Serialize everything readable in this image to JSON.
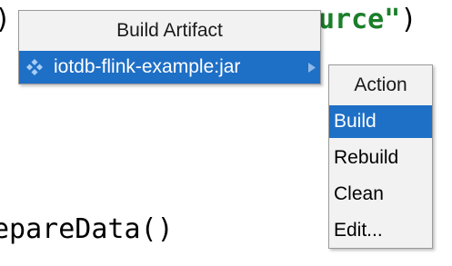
{
  "editor": {
    "top_left_fragment": ")",
    "top_right_string": "urce\"",
    "top_right_paren": ")",
    "bottom_fragment": "epareData()"
  },
  "popup": {
    "title": "Build Artifact",
    "artifact": {
      "label": "iotdb-flink-example:jar",
      "icon": "artifact-diamond-icon",
      "expand_icon": "chevron-right-icon"
    }
  },
  "submenu": {
    "title": "Action",
    "items": [
      {
        "label": "Build",
        "selected": true
      },
      {
        "label": "Rebuild",
        "selected": false
      },
      {
        "label": "Clean",
        "selected": false
      },
      {
        "label": "Edit...",
        "selected": false
      }
    ]
  },
  "colors": {
    "selection": "#1e6fc6",
    "menu_background": "#f2f2f2",
    "string_literal": "#1b7f2a"
  }
}
